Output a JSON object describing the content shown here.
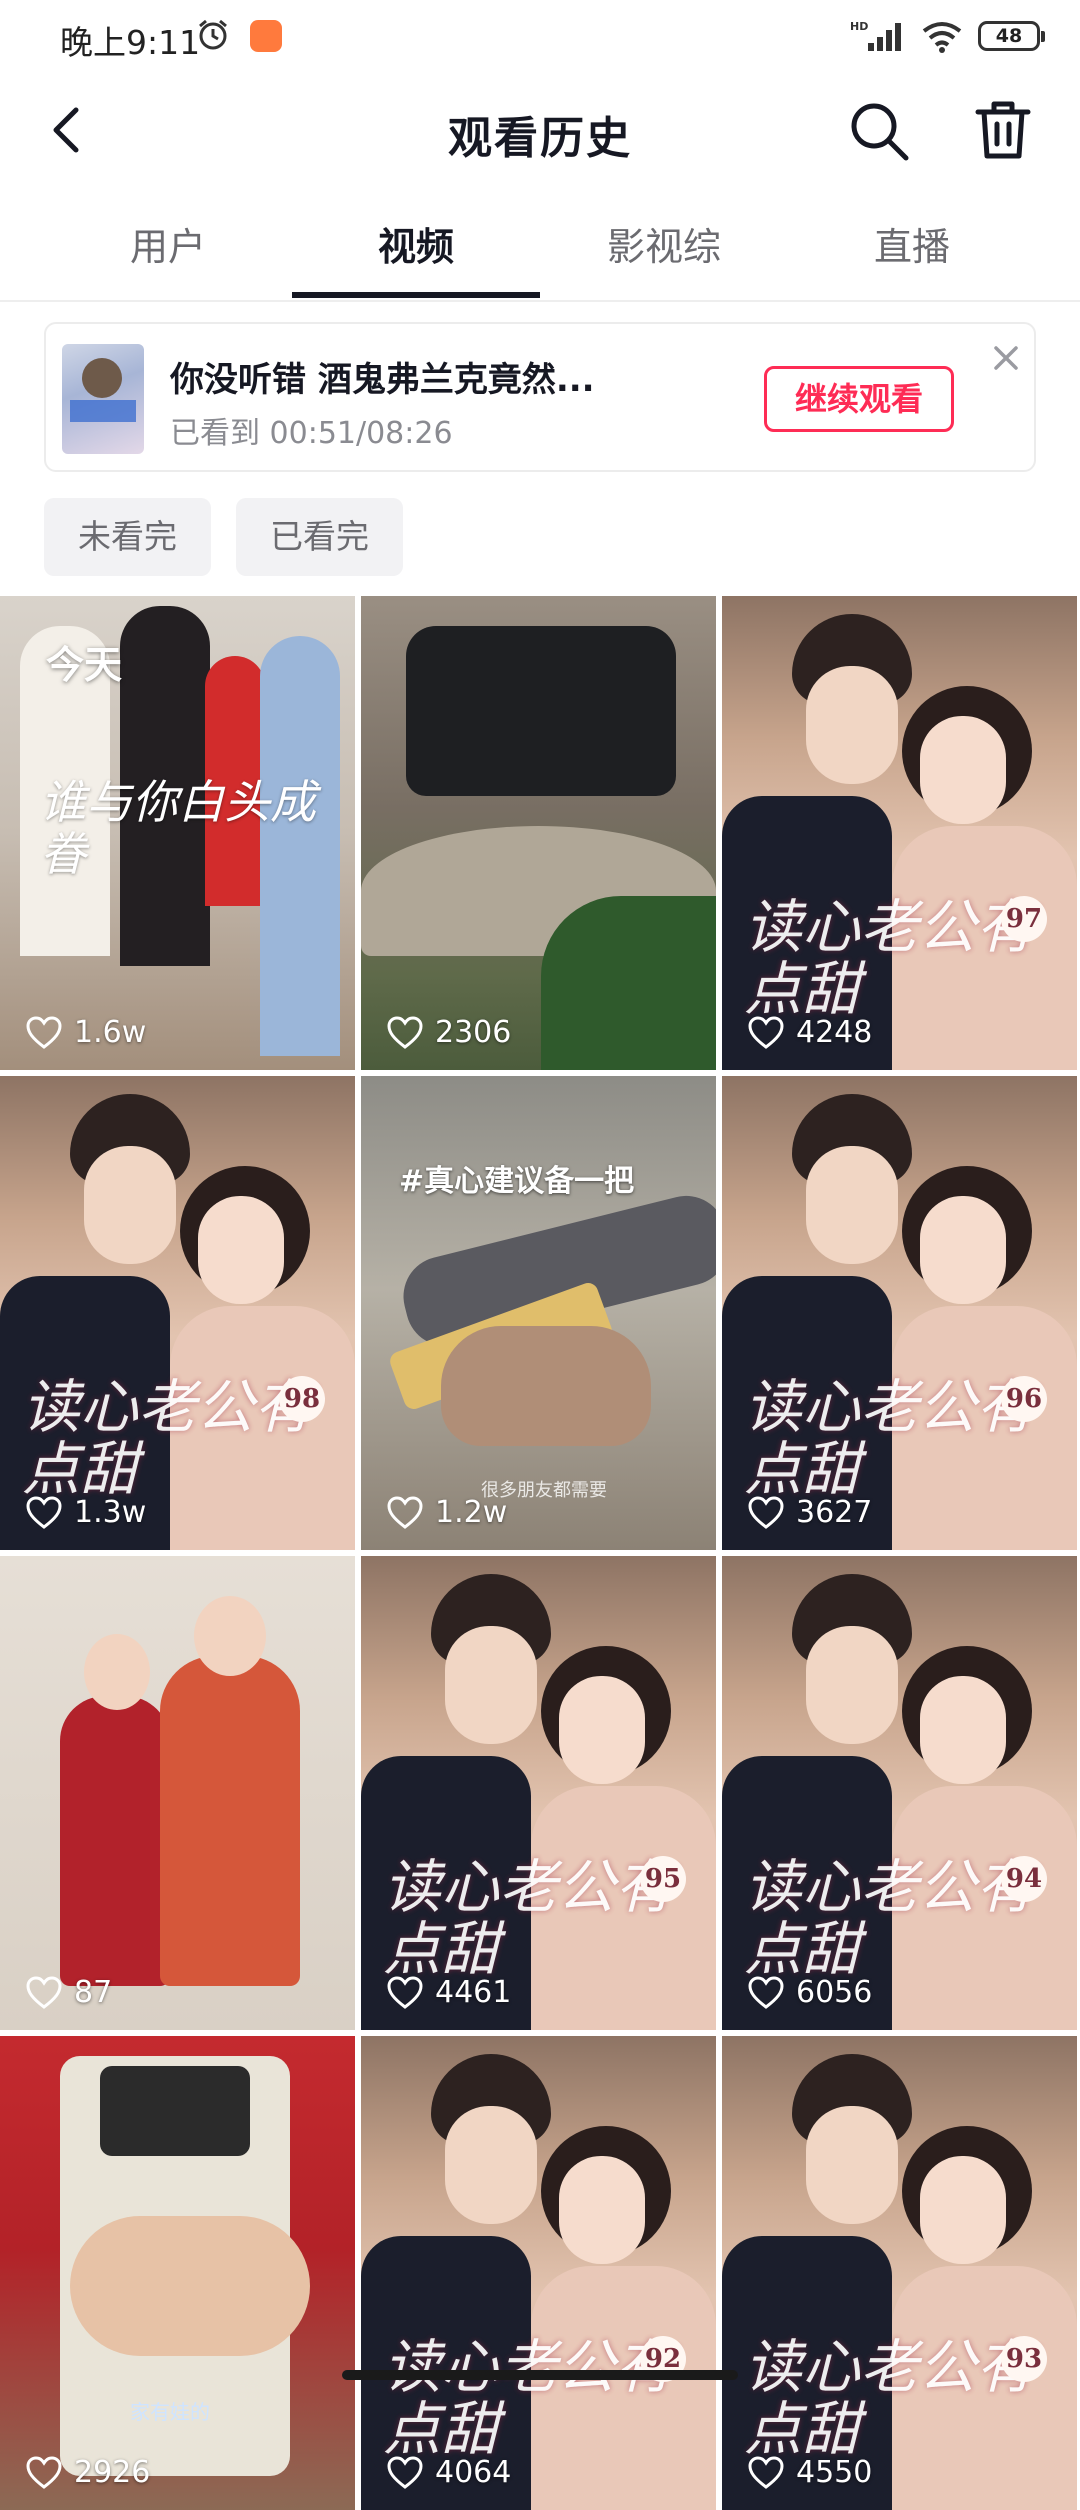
{
  "status_bar": {
    "time": "晚上9:11",
    "battery": "48",
    "network": "HD"
  },
  "nav": {
    "title": "观看历史"
  },
  "tabs": [
    {
      "label": "用户",
      "active": false
    },
    {
      "label": "视频",
      "active": true
    },
    {
      "label": "影视综",
      "active": false
    },
    {
      "label": "直播",
      "active": false
    }
  ],
  "continue_card": {
    "title": "你没听错 酒鬼弗兰克竟然...",
    "progress": "已看到 00:51/08:26",
    "button": "继续观看"
  },
  "filters": [
    "未看完",
    "已看完"
  ],
  "grid": {
    "section_label": "今天",
    "items": [
      {
        "likes": "1.6w",
        "caption": "谁与你白头成眷"
      },
      {
        "likes": "2306"
      },
      {
        "likes": "4248",
        "caption": "读心老公有点甜",
        "episode": "97"
      },
      {
        "likes": "1.3w",
        "caption": "读心老公有点甜",
        "episode": "98"
      },
      {
        "likes": "1.2w",
        "caption": "#真心建议备一把",
        "subtitle": "很多朋友都需要"
      },
      {
        "likes": "3627",
        "caption": "读心老公有点甜",
        "episode": "96"
      },
      {
        "likes": "87"
      },
      {
        "likes": "4461",
        "caption": "读心老公有点甜",
        "episode": "95"
      },
      {
        "likes": "6056",
        "caption": "读心老公有点甜",
        "episode": "94"
      },
      {
        "likes": "2926",
        "subtitle": "家有娃的"
      },
      {
        "likes": "4064",
        "caption": "读心老公有点甜",
        "episode": "92"
      },
      {
        "likes": "4550",
        "caption": "读心老公有点甜",
        "episode": "93"
      }
    ]
  },
  "colors": {
    "accent": "#fe2c55",
    "text": "#161823",
    "muted": "#8a8b91"
  }
}
